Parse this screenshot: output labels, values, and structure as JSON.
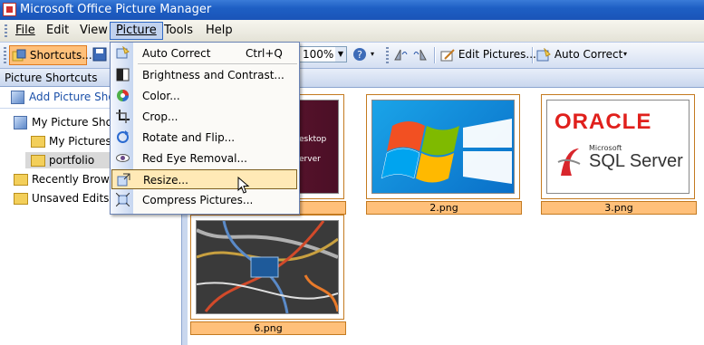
{
  "window": {
    "title": "Microsoft Office Picture Manager"
  },
  "menubar": {
    "items": [
      {
        "label": "File"
      },
      {
        "label": "Edit"
      },
      {
        "label": "View"
      },
      {
        "label": "Picture"
      },
      {
        "label": "Tools"
      },
      {
        "label": "Help"
      }
    ]
  },
  "toolbar": {
    "shortcuts_label": "Shortcuts...",
    "zoom_value": "100%",
    "edit_pictures_label": "Edit Pictures...",
    "auto_correct_label": "Auto Correct"
  },
  "picture_menu": {
    "items": [
      {
        "label": "Auto Correct",
        "shortcut": "Ctrl+Q",
        "icon": "auto-correct-icon"
      },
      {
        "label": "Brightness and Contrast...",
        "icon": "brightness-icon"
      },
      {
        "label": "Color...",
        "icon": "color-wheel-icon"
      },
      {
        "label": "Crop...",
        "icon": "crop-icon"
      },
      {
        "label": "Rotate and Flip...",
        "icon": "rotate-icon"
      },
      {
        "label": "Red Eye Removal...",
        "icon": "red-eye-icon"
      },
      {
        "label": "Resize...",
        "icon": "resize-icon"
      },
      {
        "label": "Compress Pictures...",
        "icon": "compress-icon"
      }
    ]
  },
  "left_pane": {
    "header": "Picture Shortcuts",
    "add_shortcut": "Add Picture Shortcut",
    "tree": [
      {
        "label": "My Picture Shortcuts"
      },
      {
        "label": "My Pictures"
      },
      {
        "label": "portfolio"
      },
      {
        "label": "Recently Browsed"
      },
      {
        "label": "Unsaved Edits"
      }
    ]
  },
  "thumbnails": [
    {
      "caption": "",
      "partial_text_1": "esktop",
      "partial_text_2": "erver"
    },
    {
      "caption": "2.png"
    },
    {
      "caption": "3.png",
      "logo_text": "ORACLE",
      "sub_text_1": "Microsoft",
      "sub_text_2": "SQL Server"
    },
    {
      "caption": "6.png"
    }
  ],
  "colors": {
    "accent": "#316ac5",
    "highlight": "#ffc07a",
    "menu_highlight": "#ffe9b6"
  }
}
